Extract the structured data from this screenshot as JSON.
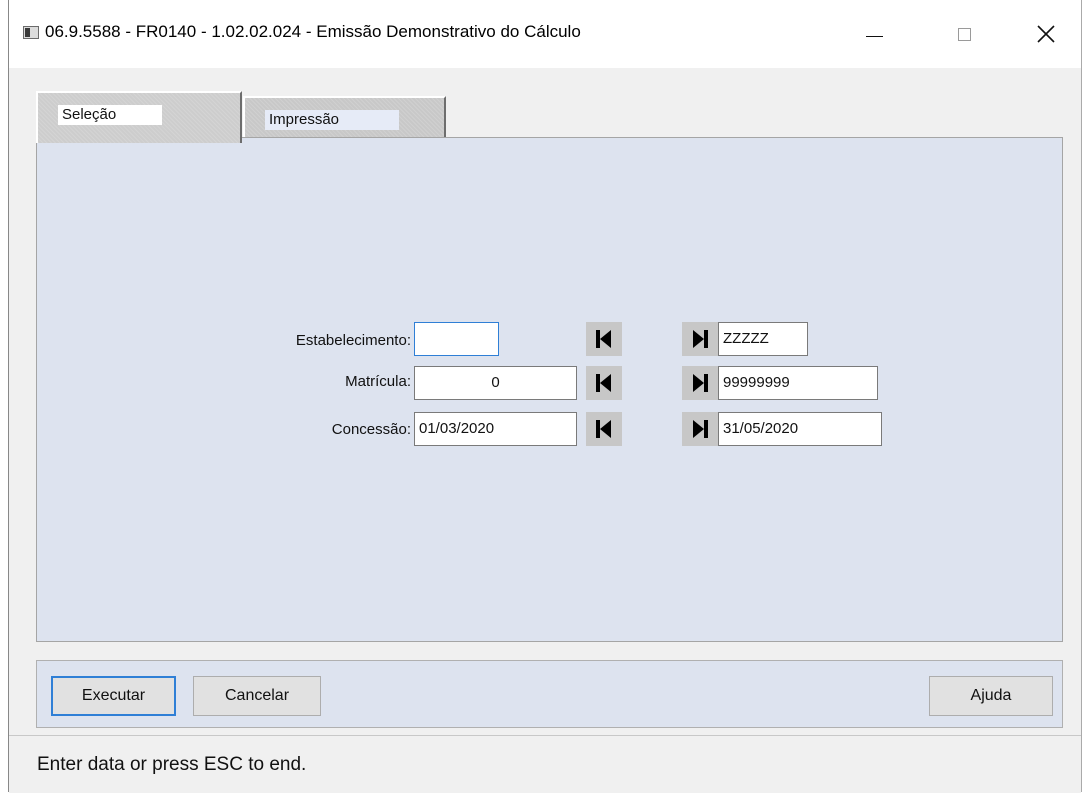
{
  "window": {
    "title": "06.9.5588 - FR0140 - 1.02.02.024 - Emissão Demonstrativo do Cálculo",
    "minimize_icon": "minimize-icon",
    "maximize_icon": "maximize-icon",
    "close_icon": "close-icon",
    "close_glyph": "✕"
  },
  "tabs": [
    {
      "label": "Seleção",
      "active": true
    },
    {
      "label": "Impressão",
      "active": false
    }
  ],
  "form": {
    "rows": [
      {
        "label": "Estabelecimento:",
        "from_value": "",
        "to_value": "ZZZZZ"
      },
      {
        "label": "Matrícula:",
        "from_value": "0",
        "to_value": "99999999"
      },
      {
        "label": "Concessão:",
        "from_value": "01/03/2020",
        "to_value": "31/05/2020"
      }
    ],
    "first_icon": "first-record-icon",
    "last_icon": "last-record-icon"
  },
  "buttons": {
    "executar": "Executar",
    "cancelar": "Cancelar",
    "ajuda": "Ajuda"
  },
  "status": {
    "message": "Enter data or press ESC to end."
  },
  "colors": {
    "panel_bg": "#dde3ef",
    "focus_border": "#2f7fd6",
    "nav_button_bg": "#c7c7c7"
  }
}
